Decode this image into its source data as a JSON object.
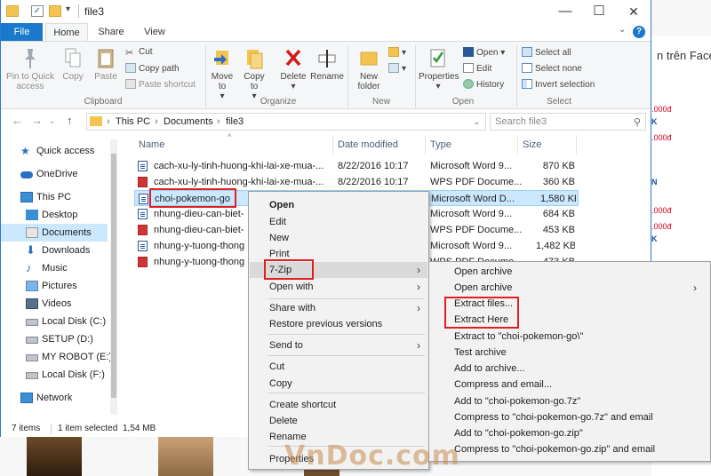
{
  "window": {
    "title": "file3",
    "controls": {
      "minimize": "—",
      "maximize": "☐",
      "close": "✕"
    }
  },
  "tabs": [
    "File",
    "Home",
    "Share",
    "View"
  ],
  "ribbon": {
    "clipboard": {
      "pin": "Pin to Quick access",
      "copy": "Copy",
      "paste": "Paste",
      "cut": "Cut",
      "copy_path": "Copy path",
      "paste_shortcut": "Paste shortcut",
      "label": "Clipboard"
    },
    "organize": {
      "move_to": "Move to",
      "copy_to": "Copy to",
      "delete": "Delete",
      "rename": "Rename",
      "label": "Organize"
    },
    "new": {
      "new_folder": "New folder",
      "label": "New"
    },
    "open": {
      "properties": "Properties",
      "open": "Open",
      "edit": "Edit",
      "history": "History",
      "label": "Open"
    },
    "select": {
      "select_all": "Select all",
      "select_none": "Select none",
      "invert": "Invert selection",
      "label": "Select"
    }
  },
  "address": {
    "crumbs": [
      "This PC",
      "Documents",
      "file3"
    ],
    "search_placeholder": "Search file3"
  },
  "nav": [
    {
      "label": "Quick access",
      "icon": "star-icon"
    },
    {
      "label": "OneDrive",
      "icon": "cloud-icon"
    },
    {
      "label": "This PC",
      "icon": "pc-icon"
    },
    {
      "label": "Desktop",
      "icon": "desktop-icon"
    },
    {
      "label": "Documents",
      "icon": "documents-icon"
    },
    {
      "label": "Downloads",
      "icon": "download-icon"
    },
    {
      "label": "Music",
      "icon": "music-icon"
    },
    {
      "label": "Pictures",
      "icon": "pictures-icon"
    },
    {
      "label": "Videos",
      "icon": "videos-icon"
    },
    {
      "label": "Local Disk (C:)",
      "icon": "drive-icon"
    },
    {
      "label": "SETUP (D:)",
      "icon": "drive-icon"
    },
    {
      "label": "MY ROBOT (E:)",
      "icon": "drive-icon"
    },
    {
      "label": "Local Disk (F:)",
      "icon": "drive-icon"
    },
    {
      "label": "Network",
      "icon": "network-icon"
    }
  ],
  "columns": [
    "Name",
    "Date modified",
    "Type",
    "Size"
  ],
  "files": [
    {
      "name": "cach-xu-ly-tinh-huong-khi-lai-xe-mua-...",
      "date": "8/22/2016 10:17",
      "type": "Microsoft Word 9...",
      "size": "870 KB",
      "kind": "doc"
    },
    {
      "name": "cach-xu-ly-tinh-huong-khi-lai-xe-mua-...",
      "date": "8/22/2016 10:17",
      "type": "WPS PDF Docume...",
      "size": "360 KB",
      "kind": "pdf"
    },
    {
      "name": "choi-pokemon-go",
      "date": "",
      "type": "Microsoft Word D...",
      "size": "1,580 KB",
      "kind": "doc"
    },
    {
      "name": "nhung-dieu-can-biet-",
      "date": "",
      "type": "Microsoft Word 9...",
      "size": "684 KB",
      "kind": "doc"
    },
    {
      "name": "nhung-dieu-can-biet-",
      "date": "",
      "type": "WPS PDF Docume...",
      "size": "453 KB",
      "kind": "pdf"
    },
    {
      "name": "nhung-y-tuong-thong",
      "date": "",
      "type": "Microsoft Word 9...",
      "size": "1,482 KB",
      "kind": "doc"
    },
    {
      "name": "nhung-y-tuong-thong",
      "date": "",
      "type": "WPS PDF Docume...",
      "size": "473 KB",
      "kind": "pdf"
    }
  ],
  "status": {
    "items": "7 items",
    "selected": "1 item selected",
    "size": "1,54 MB"
  },
  "context_menu": [
    {
      "label": "Open",
      "bold": true
    },
    {
      "label": "Edit"
    },
    {
      "label": "New"
    },
    {
      "label": "Print"
    },
    {
      "label": "7-Zip",
      "arrow": true,
      "highlight": true
    },
    {
      "label": "Open with",
      "arrow": true
    },
    {
      "label": "Share with",
      "arrow": true
    },
    {
      "label": "Restore previous versions"
    },
    {
      "label": "Send to",
      "arrow": true
    },
    {
      "label": "Cut"
    },
    {
      "label": "Copy"
    },
    {
      "label": "Create shortcut"
    },
    {
      "label": "Delete"
    },
    {
      "label": "Rename"
    },
    {
      "label": "Properties"
    }
  ],
  "submenu": [
    "Open archive",
    "Open archive",
    "Extract files...",
    "Extract Here",
    "Extract to \"choi-pokemon-go\\\"",
    "Test archive",
    "Add to archive...",
    "Compress and email...",
    "Add to \"choi-pokemon-go.7z\"",
    "Compress to \"choi-pokemon-go.7z\" and email",
    "Add to \"choi-pokemon-go.zip\"",
    "Compress to \"choi-pokemon-go.zip\" and email"
  ],
  "background": {
    "facebook_text": "n trên Faceb",
    "prices": [
      ".000đ",
      ".000đ",
      ".000đ",
      ".000đ"
    ],
    "letters": [
      "K",
      "N",
      "K"
    ]
  },
  "watermark": "VnDoc.com",
  "colors": {
    "accent": "#1979ca",
    "selection": "#cce8ff",
    "highlight_box": "#e02020"
  }
}
